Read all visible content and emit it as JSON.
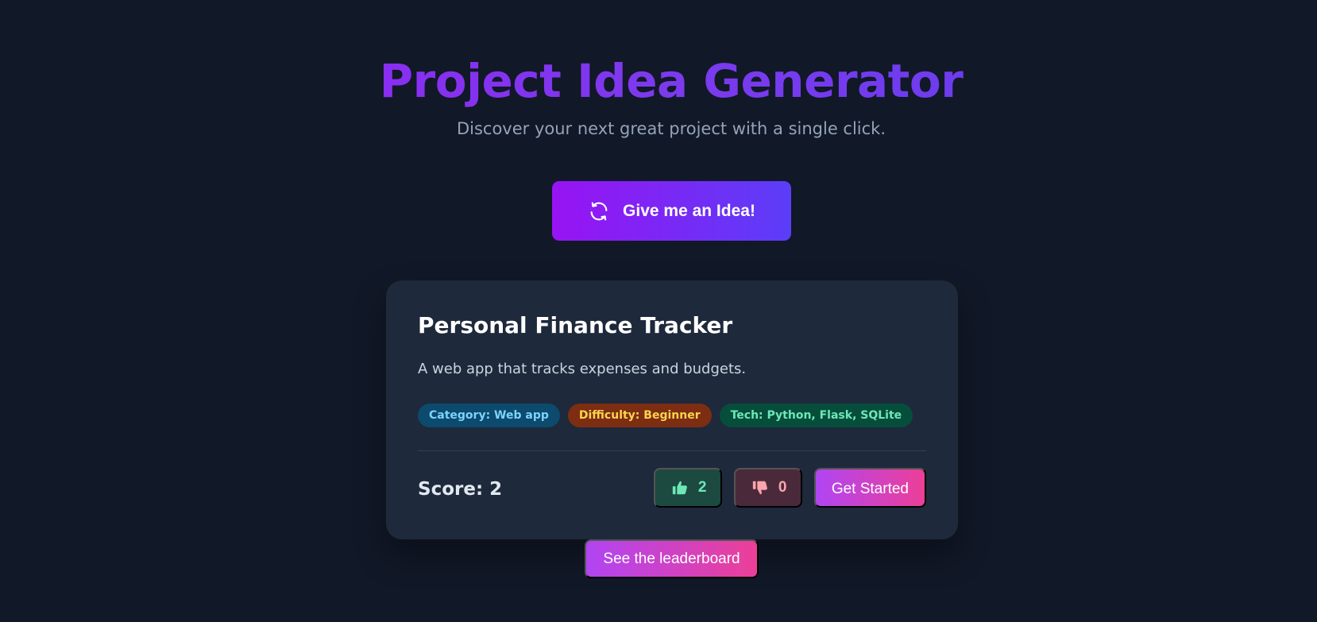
{
  "header": {
    "title": "Project Idea Generator",
    "subtitle": "Discover your next great project with a single click."
  },
  "generate_button": {
    "label": "Give me an Idea!",
    "icon": "refresh-icon"
  },
  "idea": {
    "title": "Personal Finance Tracker",
    "description": "A web app that tracks expenses and budgets.",
    "tags": {
      "category": "Category: Web app",
      "difficulty": "Difficulty: Beginner",
      "tech": "Tech: Python, Flask, SQLite"
    },
    "score_label": "Score: 2",
    "upvotes": "2",
    "downvotes": "0",
    "upvote_icon": "thumbs-up-icon",
    "downvote_icon": "thumbs-down-icon",
    "cta_label": "Get Started"
  },
  "leaderboard_button": {
    "label": "See the leaderboard"
  },
  "colors": {
    "background": "#111827",
    "card": "#1e293b",
    "accent_purple": "#9813f3",
    "accent_indigo": "#5b3ef7",
    "accent_pink": "#ec3f97"
  }
}
